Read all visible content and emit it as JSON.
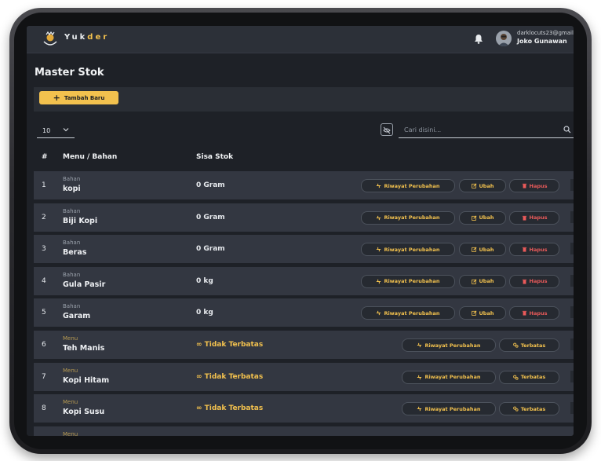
{
  "app": {
    "brand_a": "Yuk",
    "brand_b": "der",
    "user_email": "darklocuts23@gmail",
    "user_name": "Joko Gunawan"
  },
  "page": {
    "title": "Master Stok",
    "add_button": "Tambah Baru",
    "page_size": "10",
    "search_placeholder": "Cari disini..."
  },
  "table": {
    "headers": [
      "#",
      "Menu / Bahan",
      "Sisa Stok"
    ],
    "rows": [
      {
        "no": "1",
        "type": "Bahan",
        "name": "kopi",
        "stock": "0 Gram",
        "actions": [
          "Riwayat Perubahan",
          "Ubah",
          "Hapus"
        ]
      },
      {
        "no": "2",
        "type": "Bahan",
        "name": "Biji Kopi",
        "stock": "0 Gram",
        "actions": [
          "Riwayat Perubahan",
          "Ubah",
          "Hapus"
        ]
      },
      {
        "no": "3",
        "type": "Bahan",
        "name": "Beras",
        "stock": "0 Gram",
        "actions": [
          "Riwayat Perubahan",
          "Ubah",
          "Hapus"
        ]
      },
      {
        "no": "4",
        "type": "Bahan",
        "name": "Gula Pasir",
        "stock": "0 kg",
        "actions": [
          "Riwayat Perubahan",
          "Ubah",
          "Hapus"
        ]
      },
      {
        "no": "5",
        "type": "Bahan",
        "name": "Garam",
        "stock": "0 kg",
        "actions": [
          "Riwayat Perubahan",
          "Ubah",
          "Hapus"
        ]
      },
      {
        "no": "6",
        "type": "Menu",
        "name": "Teh Manis",
        "stock": "Tidak Terbatas",
        "actions": [
          "Riwayat Perubahan",
          "Terbatas"
        ]
      },
      {
        "no": "7",
        "type": "Menu",
        "name": "Kopi Hitam",
        "stock": "Tidak Terbatas",
        "actions": [
          "Riwayat Perubahan",
          "Terbatas"
        ]
      },
      {
        "no": "8",
        "type": "Menu",
        "name": "Kopi Susu",
        "stock": "Tidak Terbatas",
        "actions": [
          "Riwayat Perubahan",
          "Terbatas"
        ]
      },
      {
        "no": "",
        "type": "Menu",
        "name": "",
        "stock": "",
        "actions": []
      }
    ]
  },
  "colors": {
    "accent": "#f2c14e",
    "danger": "#ea5a5a",
    "row_bg": "#333741",
    "page_bg": "#1e2127"
  },
  "icons": [
    "logo-icon",
    "bell-icon",
    "avatar",
    "chevron-down-icon",
    "filter-icon",
    "search-icon",
    "history-icon",
    "edit-icon",
    "trash-icon",
    "infinity-icon",
    "limit-icon"
  ]
}
